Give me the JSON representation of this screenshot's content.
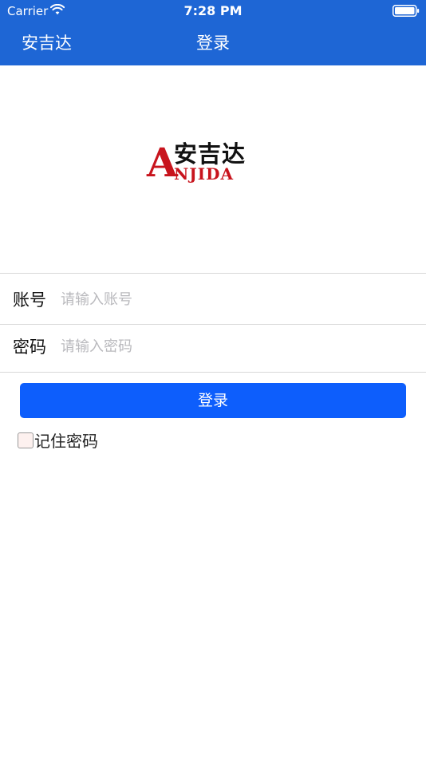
{
  "status_bar": {
    "carrier": "Carrier",
    "time": "7:28 PM",
    "wifi_icon": "wifi-icon",
    "battery_icon": "battery-icon"
  },
  "nav": {
    "left_label": "安吉达",
    "title": "登录",
    "background_color": "#1e66d5"
  },
  "logo": {
    "cn_text": "安吉达",
    "en_initial": "A",
    "en_text": "NJIDA",
    "brand_color": "#c8141d"
  },
  "form": {
    "account": {
      "label": "账号",
      "value": "",
      "placeholder": "请输入账号"
    },
    "password": {
      "label": "密码",
      "value": "",
      "placeholder": "请输入密码"
    },
    "login_button": {
      "label": "登录",
      "color": "#0d5efc"
    },
    "remember": {
      "label": "记住密码",
      "checked": false
    }
  }
}
